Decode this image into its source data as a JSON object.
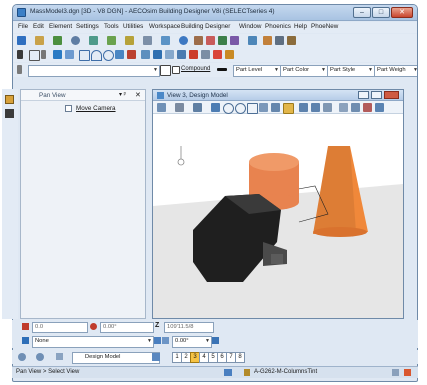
{
  "window": {
    "title": "MassModel3.dgn [3D - V8 DGN] - AECOsim Building Designer V8i (SELECTseries 4)",
    "min_label": "–",
    "max_label": "□",
    "close_label": "✕"
  },
  "menu": {
    "items": [
      "File",
      "Edit",
      "Element",
      "Settings",
      "Tools",
      "Utilities",
      "Workspace",
      "Building Designer",
      "Window",
      "Phoenics",
      "Help",
      "PhoeNew"
    ]
  },
  "attributes_bar": {
    "compound_label": "Compound",
    "part_level": "Part Level",
    "part_color": "Part Color",
    "part_style": "Part Style",
    "part_weight": "Part Weigh"
  },
  "pan_panel": {
    "title": "Pan View",
    "close_label": "✕",
    "pin_label": "▾ ᵖ",
    "move_camera_label": "Move Camera"
  },
  "view": {
    "title": "View 3, Design Model",
    "sky_color": "#ffffff",
    "ground_color": "#e6e6e6",
    "cylinder_color": "#e8834f",
    "cone_color": "#f0883a",
    "block_color": "#1f1f1f"
  },
  "coords": {
    "x_value": "0.0",
    "y_value": "0.00°",
    "z_label": "Z",
    "z_value": "109'11.5/8"
  },
  "level_bar": {
    "level": "None",
    "angle": "0.00°"
  },
  "view_bar": {
    "model": "Design Model",
    "view_numbers": [
      "1",
      "2",
      "3",
      "4",
      "5",
      "6",
      "7",
      "8"
    ],
    "selected_view": "3"
  },
  "status": {
    "prompt": "Pan View > Select View",
    "level_info": "A-G262-M-ColumnsTint"
  }
}
